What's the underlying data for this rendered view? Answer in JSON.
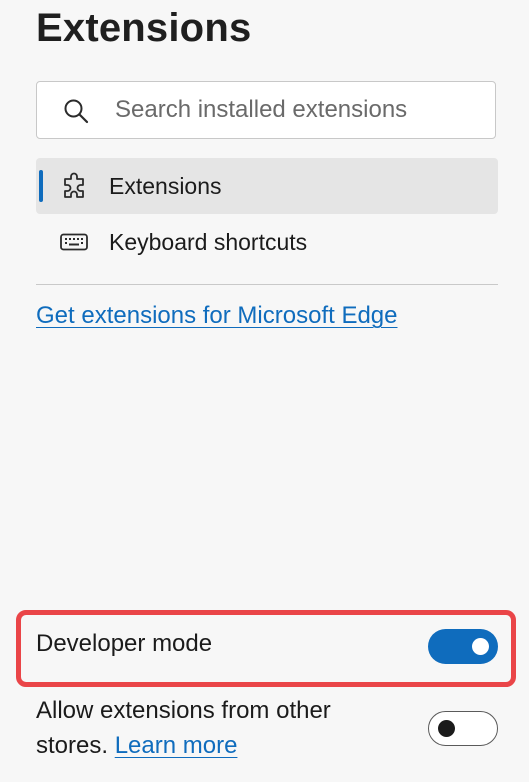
{
  "header": {
    "title": "Extensions"
  },
  "search": {
    "placeholder": "Search installed extensions",
    "value": "",
    "icon": "search-icon"
  },
  "nav": {
    "items": [
      {
        "label": "Extensions",
        "icon": "puzzle-icon",
        "selected": true
      },
      {
        "label": "Keyboard shortcuts",
        "icon": "keyboard-icon",
        "selected": false
      }
    ]
  },
  "store_link": {
    "label": "Get extensions for Microsoft Edge"
  },
  "settings": {
    "developer_mode": {
      "label": "Developer mode",
      "enabled": true
    },
    "allow_other_stores": {
      "label": "Allow extensions from other stores.",
      "learn_more": "Learn more",
      "enabled": false
    }
  },
  "colors": {
    "accent": "#0f6cbd",
    "highlight": "#ea4548",
    "background": "#f7f7f7",
    "selected_background": "#e5e5e5"
  }
}
